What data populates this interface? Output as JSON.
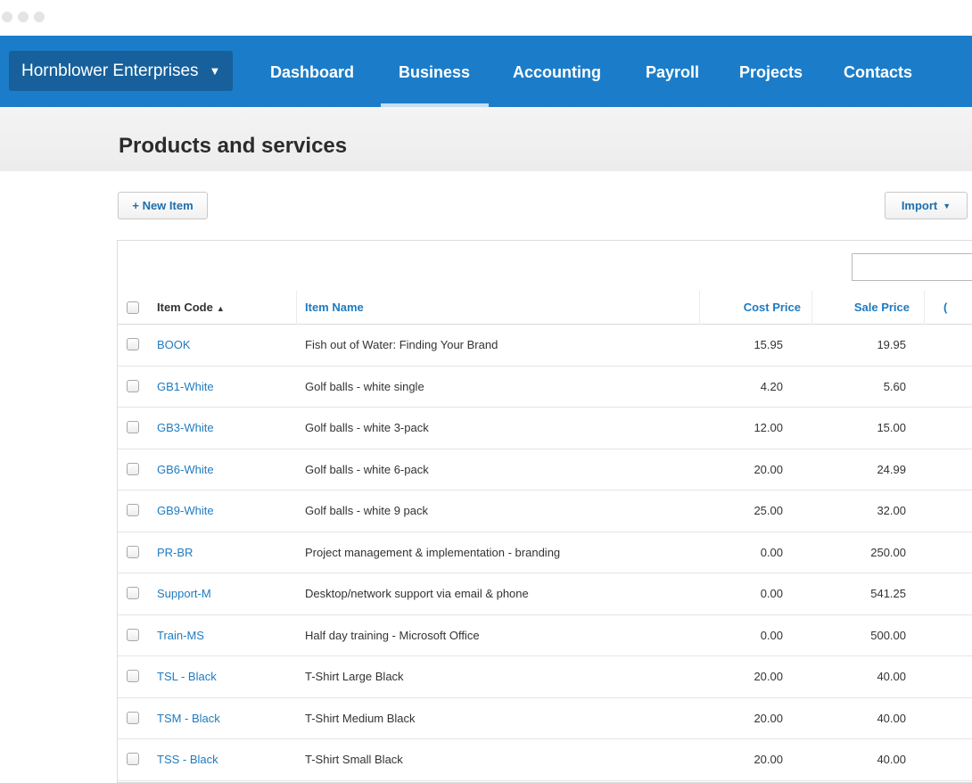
{
  "nav": {
    "org_name": "Hornblower Enterprises",
    "tabs": [
      {
        "label": "Dashboard"
      },
      {
        "label": "Business"
      },
      {
        "label": "Accounting"
      },
      {
        "label": "Payroll"
      },
      {
        "label": "Projects"
      },
      {
        "label": "Contacts"
      }
    ],
    "active_tab": "Business",
    "nav_color": "#1b7dc9"
  },
  "page": {
    "title": "Products and services"
  },
  "toolbar": {
    "new_item_label": "+ New Item",
    "import_label": "Import"
  },
  "table": {
    "columns": {
      "code": "Item Code",
      "name": "Item Name",
      "cost": "Cost Price",
      "sale": "Sale Price",
      "more": "("
    },
    "rows": [
      {
        "code": "BOOK",
        "name": "Fish out of Water: Finding Your Brand",
        "cost": "15.95",
        "sale": "19.95"
      },
      {
        "code": "GB1-White",
        "name": "Golf balls - white single",
        "cost": "4.20",
        "sale": "5.60"
      },
      {
        "code": "GB3-White",
        "name": "Golf balls - white 3-pack",
        "cost": "12.00",
        "sale": "15.00"
      },
      {
        "code": "GB6-White",
        "name": "Golf balls - white 6-pack",
        "cost": "20.00",
        "sale": "24.99"
      },
      {
        "code": "GB9-White",
        "name": "Golf balls - white 9 pack",
        "cost": "25.00",
        "sale": "32.00"
      },
      {
        "code": "PR-BR",
        "name": "Project management & implementation - branding",
        "cost": "0.00",
        "sale": "250.00"
      },
      {
        "code": "Support-M",
        "name": "Desktop/network support via email & phone",
        "cost": "0.00",
        "sale": "541.25"
      },
      {
        "code": "Train-MS",
        "name": "Half day training - Microsoft Office",
        "cost": "0.00",
        "sale": "500.00"
      },
      {
        "code": "TSL - Black",
        "name": "T-Shirt Large Black",
        "cost": "20.00",
        "sale": "40.00"
      },
      {
        "code": "TSM - Black",
        "name": "T-Shirt Medium Black",
        "cost": "20.00",
        "sale": "40.00"
      },
      {
        "code": "TSS - Black",
        "name": "T-Shirt Small Black",
        "cost": "20.00",
        "sale": "40.00"
      }
    ]
  }
}
